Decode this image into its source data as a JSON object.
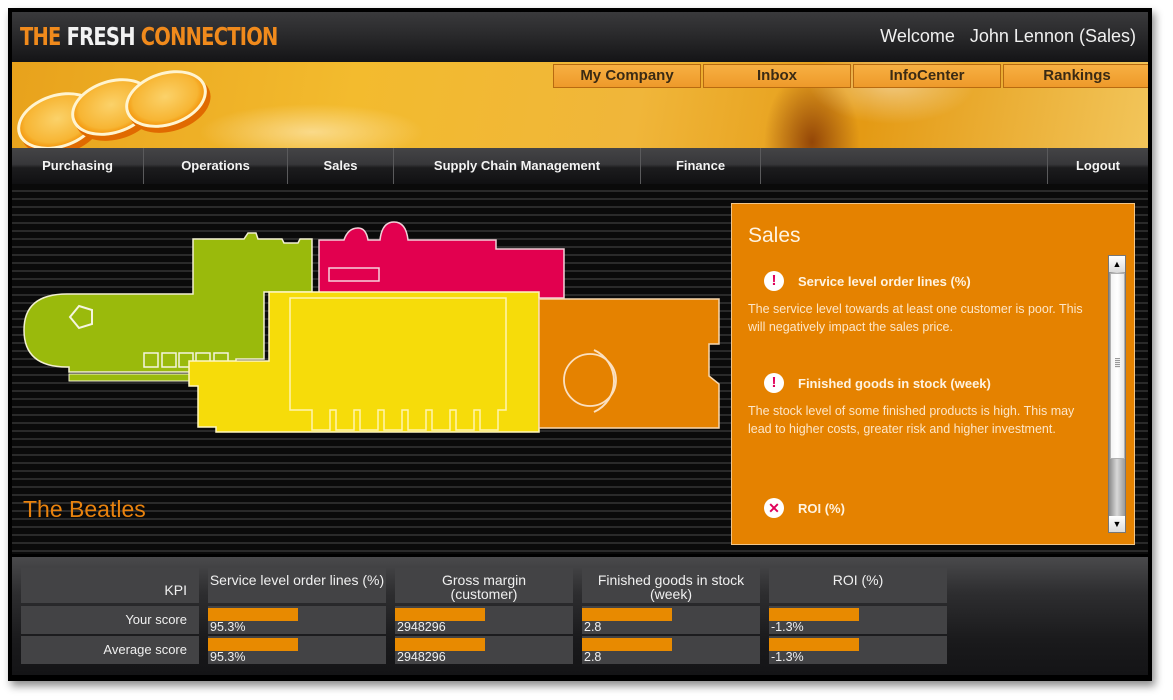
{
  "header": {
    "logo": {
      "part1": "THE ",
      "part2": "FRESH ",
      "part3": "CONNECTION"
    },
    "welcome_label": "Welcome",
    "user": "John Lennon (Sales)"
  },
  "top_tabs": [
    "My Company",
    "Inbox",
    "InfoCenter",
    "Rankings"
  ],
  "nav": {
    "items": [
      "Purchasing",
      "Operations",
      "Sales",
      "Supply Chain Management",
      "Finance"
    ],
    "logout": "Logout"
  },
  "map": {
    "team_name": "The Beatles",
    "zones": [
      {
        "name": "purchasing",
        "color": "#9aba0c"
      },
      {
        "name": "sales",
        "color": "#e2004f"
      },
      {
        "name": "operations",
        "color": "#f6dc0a"
      },
      {
        "name": "supply-chain",
        "color": "#e58200"
      }
    ]
  },
  "sales_panel": {
    "title": "Sales",
    "alerts": [
      {
        "icon": "!",
        "type": "warning",
        "title": "Service level order lines (%)",
        "body": "The service level towards at least one customer is poor. This will negatively impact the sales price."
      },
      {
        "icon": "!",
        "type": "warning",
        "title": "Finished goods in stock (week)",
        "body": "The stock level of some finished products is high. This may lead to higher costs, greater risk and higher investment."
      },
      {
        "icon": "✕",
        "type": "error",
        "title": "ROI (%)",
        "body": ""
      }
    ],
    "scroll": {
      "up": "▲",
      "down": "▼"
    }
  },
  "kpi": {
    "header_label": "KPI",
    "row_labels": [
      "Your score",
      "Average score"
    ],
    "columns": [
      {
        "title": "Service level order lines (%)",
        "your": "95.3%",
        "average": "95.3%"
      },
      {
        "title": "Gross margin (customer)",
        "your": "2948296",
        "average": "2948296"
      },
      {
        "title": "Finished goods in stock (week)",
        "your": "2.8",
        "average": "2.8"
      },
      {
        "title": "ROI (%)",
        "your": "-1.3%",
        "average": "-1.3%"
      }
    ]
  },
  "colors": {
    "accent": "#e58200",
    "brand_orange": "#f08a1c",
    "alert_pink": "#e0005a"
  }
}
